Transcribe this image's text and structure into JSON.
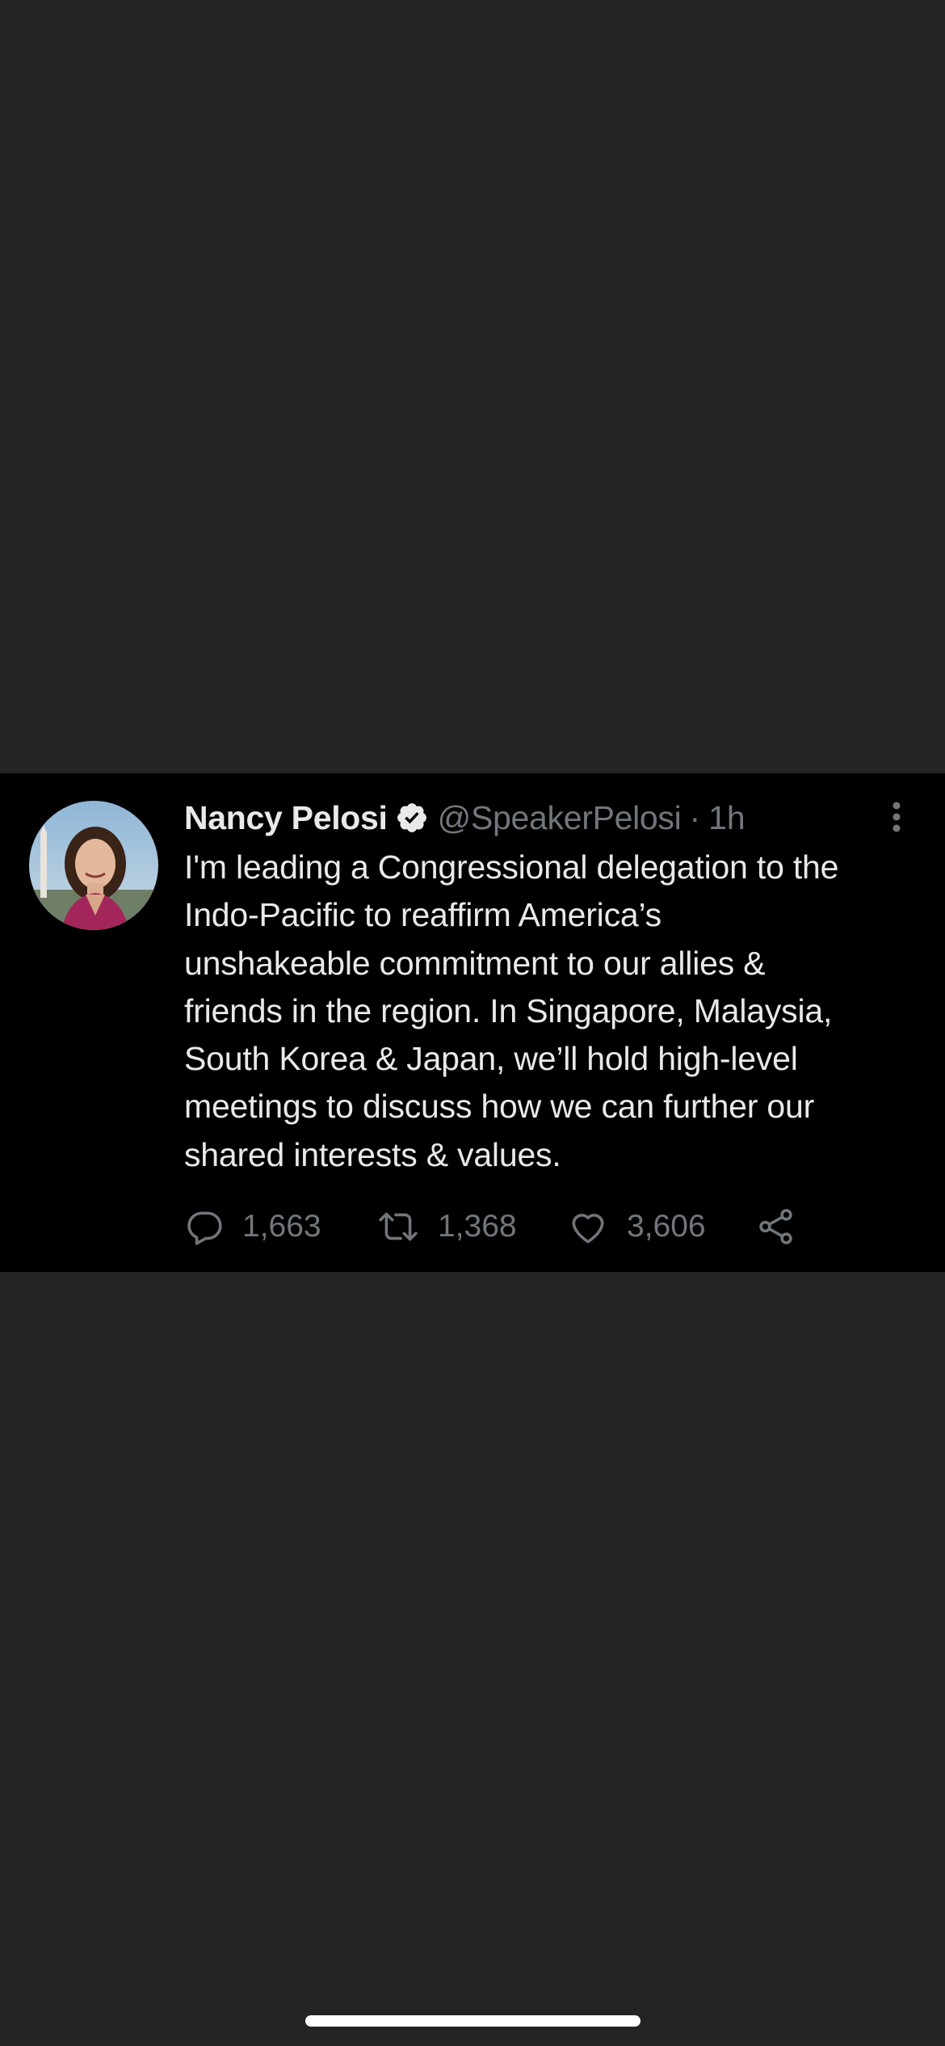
{
  "tweet": {
    "author_name": "Nancy Pelosi",
    "handle": "@SpeakerPelosi",
    "separator": "·",
    "time": "1h",
    "text_lines": [
      "I'm leading a Congressional delegation to the",
      "Indo-Pacific to reaffirm America’s",
      "unshakeable commitment to our allies &",
      "friends in the region. In Singapore, Malaysia,",
      "South Korea & Japan, we’ll hold high-level",
      "meetings to discuss how we can further our",
      "shared interests & values."
    ],
    "replies": "1,663",
    "retweets": "1,368",
    "likes": "3,606"
  },
  "icons": {
    "verified": "verified-badge-icon",
    "more": "more-vertical-icon",
    "reply": "reply-icon",
    "retweet": "retweet-icon",
    "like": "heart-icon",
    "share": "share-icon"
  },
  "colors": {
    "page_background": "#242426",
    "tweet_background": "#000000",
    "primary_text": "#e7e9ea",
    "secondary_text": "#71767b"
  }
}
